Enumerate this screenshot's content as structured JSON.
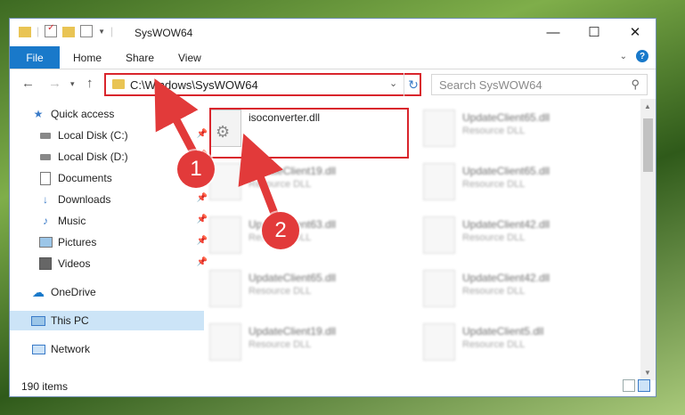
{
  "window": {
    "title": "SysWOW64"
  },
  "ribbon": {
    "file": "File",
    "tabs": [
      "Home",
      "Share",
      "View"
    ]
  },
  "nav": {
    "address": "C:\\Windows\\SysWOW64",
    "search_placeholder": "Search SysWOW64"
  },
  "sidebar": {
    "items": [
      {
        "label": "Quick access",
        "icon": "star-icon"
      },
      {
        "label": "Local Disk (C:)",
        "icon": "drive-icon",
        "pinned": true
      },
      {
        "label": "Local Disk (D:)",
        "icon": "drive-icon",
        "pinned": true
      },
      {
        "label": "Documents",
        "icon": "documents-icon",
        "pinned": true
      },
      {
        "label": "Downloads",
        "icon": "download-icon",
        "pinned": true
      },
      {
        "label": "Music",
        "icon": "music-icon",
        "pinned": true
      },
      {
        "label": "Pictures",
        "icon": "pictures-icon",
        "pinned": true
      },
      {
        "label": "Videos",
        "icon": "videos-icon",
        "pinned": true
      },
      {
        "label": "OneDrive",
        "icon": "cloud-icon"
      },
      {
        "label": "This PC",
        "icon": "computer-icon",
        "selected": true
      },
      {
        "label": "Network",
        "icon": "network-icon"
      }
    ]
  },
  "files": {
    "col1": [
      {
        "name": "isoconverter.dll",
        "type": ""
      },
      {
        "name": "UpdateClient19.dll",
        "type": "Resource DLL"
      },
      {
        "name": "UpdateClient63.dll",
        "type": "Resource DLL"
      },
      {
        "name": "UpdateClient65.dll",
        "type": "Resource DLL"
      },
      {
        "name": "UpdateClient19.dll",
        "type": "Resource DLL"
      }
    ],
    "col2": [
      {
        "name": "UpdateClient65.dll",
        "type": "Resource DLL"
      },
      {
        "name": "UpdateClient65.dll",
        "type": "Resource DLL"
      },
      {
        "name": "UpdateClient42.dll",
        "type": "Resource DLL"
      },
      {
        "name": "UpdateClient42.dll",
        "type": "Resource DLL"
      },
      {
        "name": "UpdateClient5.dll",
        "type": "Resource DLL"
      }
    ]
  },
  "status": {
    "items": "190 items"
  },
  "callouts": [
    "1",
    "2"
  ],
  "colors": {
    "accent": "#1979ca",
    "highlight": "#d9252c",
    "callout": "#e23a3a"
  }
}
